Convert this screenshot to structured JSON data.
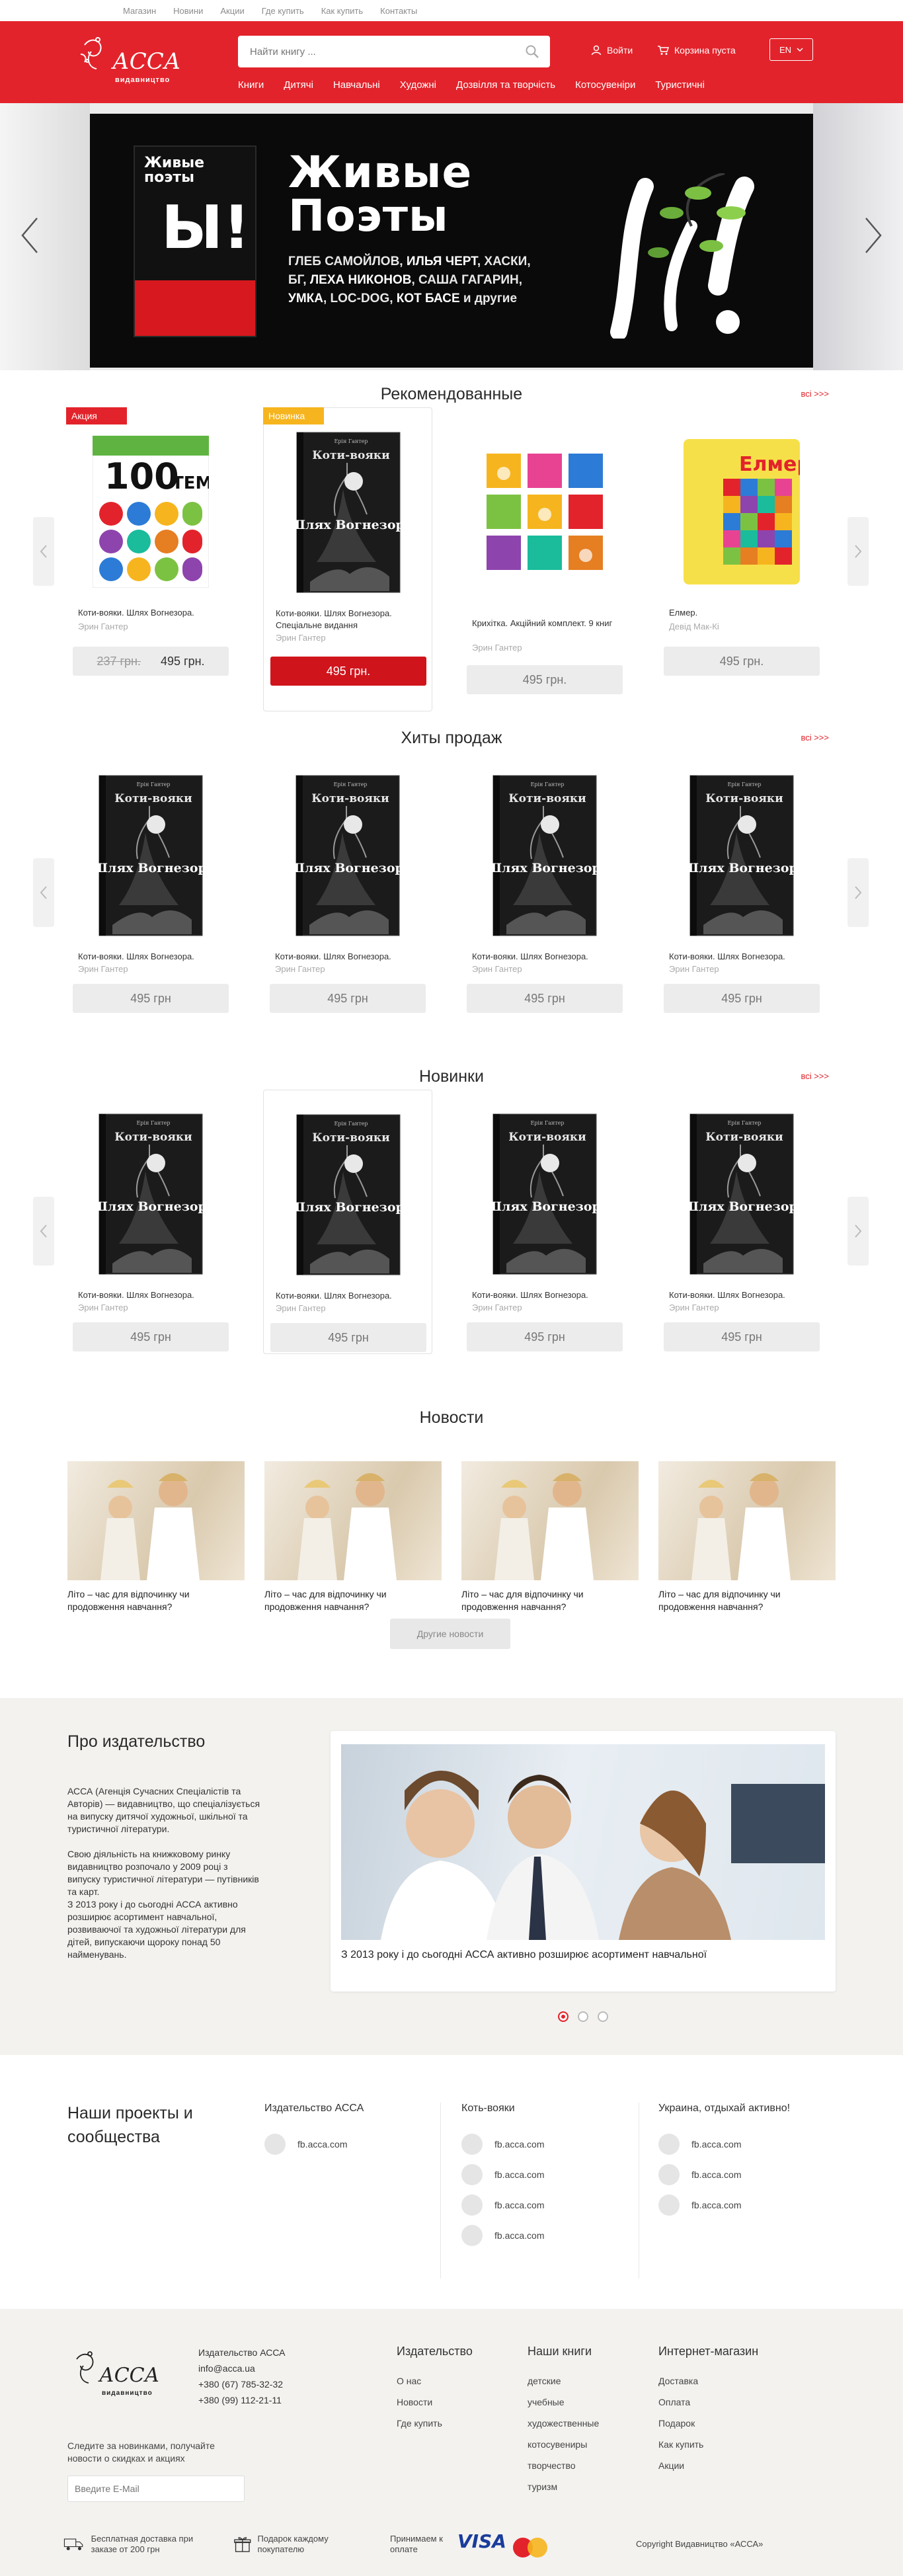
{
  "topbar": {
    "links": [
      "Магазин",
      "Новини",
      "Акции",
      "Где купить",
      "Как купить",
      "Контакты"
    ]
  },
  "header": {
    "logo_text": "АССА",
    "logo_sub": "видавництво",
    "search_placeholder": "Найти книгу ...",
    "login": "Войти",
    "cart": "Корзина пуста",
    "lang": "EN",
    "nav": [
      "Книги",
      "Дитячі",
      "Навчальні",
      "Художні",
      "Дозвілля та творчість",
      "Котосувеніри",
      "Туристичні"
    ]
  },
  "hero": {
    "book_title": "Живые поэты",
    "title_line1": "Живые",
    "title_line2": "Поэты",
    "text_before": "ГЛЕБ САМОЙЛОВ, ",
    "text_bold1": "ИЛЬЯ ЧЕРТ",
    "text_mid1": ", ХАСКИ, БГ, ",
    "text_bold2": "ЛЕХА НИКОНОВ",
    "text_mid2": ", САША ГАГАРИН, ",
    "text_bold3": "УМКА",
    "text_mid3": ", LOC-DOG, ",
    "text_bold4": "КОТ БАСЕ",
    "text_after": " и другие",
    "big_word": "Ы!"
  },
  "recommended": {
    "title": "Рекомендованные",
    "all_link": "всі >>>",
    "items": [
      {
        "badge": "Акция",
        "name": "Коти-вояки. Шлях Вогнезора.",
        "author": "Эрин Гантер",
        "old_price": "237 грн.",
        "price": "495 грн."
      },
      {
        "badge": "Новинка",
        "name": "Коти-вояки. Шлях Вогнезора. Спеціальне видання",
        "author": "Эрин Гантер",
        "price": "495 грн."
      },
      {
        "name": "Крихітка. Акційний комплект. 9 книг",
        "author": "Эрин Гантер",
        "price": "495 грн."
      },
      {
        "name": "Елмер.",
        "author": "Девід Мак-Кі",
        "price": "495 грн."
      }
    ]
  },
  "hits": {
    "title": "Хиты продаж",
    "all_link": "всі >>>",
    "items": [
      {
        "name": "Коти-вояки. Шлях Вогнезора.",
        "author": "Эрин Гантер",
        "price": "495 грн"
      },
      {
        "name": "Коти-вояки. Шлях Вогнезора.",
        "author": "Эрин Гантер",
        "price": "495 грн"
      },
      {
        "name": "Коти-вояки. Шлях Вогнезора.",
        "author": "Эрин Гантер",
        "price": "495 грн"
      },
      {
        "name": "Коти-вояки. Шлях Вогнезора.",
        "author": "Эрин Гантер",
        "price": "495 грн"
      }
    ]
  },
  "novelties": {
    "title": "Новинки",
    "all_link": "всі >>>",
    "items": [
      {
        "name": "Коти-вояки. Шлях Вогнезора.",
        "author": "Эрин Гантер",
        "price": "495 грн"
      },
      {
        "name": "Коти-вояки. Шлях Вогнезора.",
        "author": "Эрин Гантер",
        "price": "495 грн"
      },
      {
        "name": "Коти-вояки. Шлях Вогнезора.",
        "author": "Эрин Гантер",
        "price": "495 грн"
      },
      {
        "name": "Коти-вояки. Шлях Вогнезора.",
        "author": "Эрин Гантер",
        "price": "495 грн"
      }
    ]
  },
  "book_cover": {
    "top": "Коти-вояки",
    "main": "Шлях Вогнезора",
    "author": "Ерін Гантер"
  },
  "news": {
    "title": "Новости",
    "items": [
      "Літо – час для відпочинку чи продовження навчання?",
      "Літо – час для відпочинку чи продовження навчання?",
      "Літо – час для відпочинку чи продовження навчання?",
      "Літо – час для відпочинку чи продовження навчання?"
    ],
    "more": "Другие новости"
  },
  "about": {
    "title": "Про издательство",
    "p1": "АССА (Агенція Сучасних Спеціалістів та Авторів) — видавництво, що спеціалізується на випуску дитячої художньої, шкільної та туристичної літератури.",
    "p2": "Свою діяльність на книжковому ринку видавництво розпочало у 2009 році з випуску туристичної літератури — путівників та карт.",
    "p3": "З 2013 року і до сьогодні АССА активно розширює асортимент навчальної, розвиваючої та художньої літератури для дітей, випускаючи щороку понад 50 найменувань.",
    "caption": "З 2013 року і до сьогодні АССА активно розширює асортимент навчальної"
  },
  "projects": {
    "title": "Наши проекты и сообщества",
    "columns": [
      {
        "title": "Издательство АССА",
        "links": [
          "fb.acca.com"
        ]
      },
      {
        "title": "Коть-вояки",
        "links": [
          "fb.acca.com",
          "fb.acca.com",
          "fb.acca.com",
          "fb.acca.com"
        ]
      },
      {
        "title": "Украина, отдыхай активно!",
        "links": [
          "fb.acca.com",
          "fb.acca.com",
          "fb.acca.com"
        ]
      }
    ]
  },
  "footer": {
    "company": "Издательство АССА",
    "email": "info@acca.ua",
    "phone1": "+380 (67) 785-32-32",
    "phone2": "+380 (99) 112-21-11",
    "cols": [
      {
        "title": "Издательство",
        "links": [
          "О нас",
          "Новости",
          "Где купить"
        ]
      },
      {
        "title": "Наши книги",
        "links": [
          "детские",
          "учебные",
          "художественные",
          "котосувениры",
          "творчество",
          "туризм"
        ]
      },
      {
        "title": "Интернет-магазин",
        "links": [
          "Доставка",
          "Оплата",
          "Подарок",
          "Как купить",
          "Акции"
        ]
      }
    ],
    "subscribe": "Следите за новинками, получайте новости о скидках и акциях",
    "email_placeholder": "Введите E-Mail",
    "delivery": "Бесплатная доставка при заказе от 200 грн",
    "gift": "Подарок каждому покупателю",
    "payment": "Принимаем к оплате",
    "visa": "VISA",
    "copyright": "Copyright Видавництво «АССА»"
  },
  "colors": {
    "brand": "#e3232b",
    "sale": "#e3232b",
    "new": "#f6b51e"
  }
}
